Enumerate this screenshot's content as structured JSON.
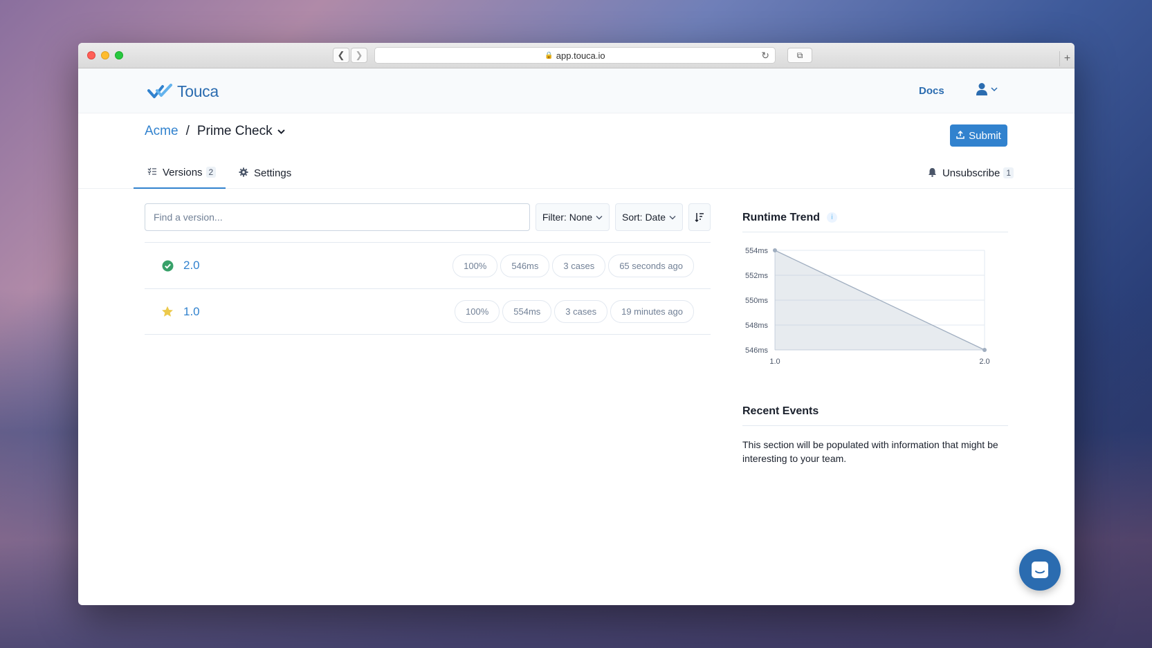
{
  "browser": {
    "url": "app.touca.io"
  },
  "header": {
    "logo_text": "Touca",
    "docs_label": "Docs"
  },
  "breadcrumb": {
    "team": "Acme",
    "separator": "/",
    "suite": "Prime Check"
  },
  "submit_label": "Submit",
  "tabs": {
    "versions_label": "Versions",
    "versions_count": "2",
    "settings_label": "Settings",
    "unsubscribe_label": "Unsubscribe",
    "unsubscribe_count": "1"
  },
  "search": {
    "placeholder": "Find a version..."
  },
  "controls": {
    "filter_label": "Filter: None",
    "sort_label": "Sort: Date"
  },
  "versions": [
    {
      "name": "2.0",
      "status_icon": "check-circle-icon",
      "score": "100%",
      "runtime": "546ms",
      "cases": "3 cases",
      "time": "65 seconds ago"
    },
    {
      "name": "1.0",
      "status_icon": "star-icon",
      "score": "100%",
      "runtime": "554ms",
      "cases": "3 cases",
      "time": "19 minutes ago"
    }
  ],
  "runtime_trend": {
    "title": "Runtime Trend"
  },
  "recent_events": {
    "title": "Recent Events",
    "text": "This section will be populated with information that might be interesting to your team."
  },
  "colors": {
    "brand": "#2b6cb0",
    "link": "#3182ce",
    "success": "#38a169",
    "star": "#ecc94b"
  },
  "chart_data": {
    "type": "area",
    "title": "Runtime Trend",
    "categories": [
      "1.0",
      "2.0"
    ],
    "values": [
      554,
      546
    ],
    "y_tick_labels": [
      "554ms",
      "552ms",
      "550ms",
      "548ms",
      "546ms"
    ],
    "y_ticks": [
      554,
      552,
      550,
      548,
      546
    ],
    "ylim": [
      546,
      554
    ],
    "grid": true
  }
}
